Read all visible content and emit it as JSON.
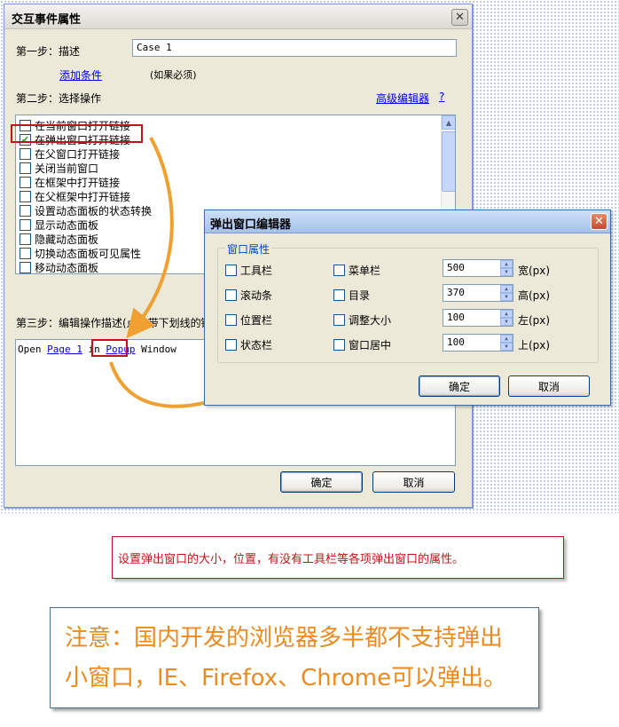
{
  "main_dialog": {
    "title": "交互事件属性",
    "step1_label": "第一步：描述",
    "case_value": "Case 1",
    "add_condition": "添加条件",
    "condition_note": "(如果必须)",
    "step2_label": "第二步：选择操作",
    "advanced_editor": "高级编辑器",
    "help": "?",
    "actions": [
      {
        "label": "在当前窗口打开链接",
        "checked": false
      },
      {
        "label": "在弹出窗口打开链接",
        "checked": true
      },
      {
        "label": "在父窗口打开链接",
        "checked": false
      },
      {
        "label": "关闭当前窗口",
        "checked": false
      },
      {
        "label": "在框架中打开链接",
        "checked": false
      },
      {
        "label": "在父框架中打开链接",
        "checked": false
      },
      {
        "label": "设置动态面板的状态转换",
        "checked": false
      },
      {
        "label": "显示动态面板",
        "checked": false
      },
      {
        "label": "隐藏动态面板",
        "checked": false
      },
      {
        "label": "切换动态面板可见属性",
        "checked": false
      },
      {
        "label": "移动动态面板",
        "checked": false
      }
    ],
    "step3_label": "第三步：编辑操作描述(点击带下划线的链",
    "desc_prefix": "Open ",
    "desc_page": "Page 1",
    "desc_mid": " in ",
    "desc_popup": "Popup",
    "desc_suffix": " Window",
    "ok": "确定",
    "cancel": "取消"
  },
  "popup_dialog": {
    "title": "弹出窗口编辑器",
    "group_title": "窗口属性",
    "options_left": [
      "工具栏",
      "滚动条",
      "位置栏",
      "状态栏"
    ],
    "options_mid": [
      "菜单栏",
      "目录",
      "调整大小",
      "窗口居中"
    ],
    "size_fields": [
      {
        "value": "500",
        "label": "宽(px)"
      },
      {
        "value": "370",
        "label": "高(px)"
      },
      {
        "value": "100",
        "label": "左(px)"
      },
      {
        "value": "100",
        "label": "上(px)"
      }
    ],
    "ok": "确定",
    "cancel": "取消"
  },
  "note_red": "设置弹出窗口的大小，位置，有没有工具栏等各项弹出窗口的属性。",
  "note_big_line1": "注意：国内开发的浏览器多半都不支持弹出",
  "note_big_line2": "小窗口，IE、Firefox、Chrome可以弹出。",
  "colors": {
    "accent_red": "#c0141c",
    "arrow_orange": "#f0a030",
    "note_orange": "#ec8a1d",
    "link_blue": "#0000ee"
  }
}
